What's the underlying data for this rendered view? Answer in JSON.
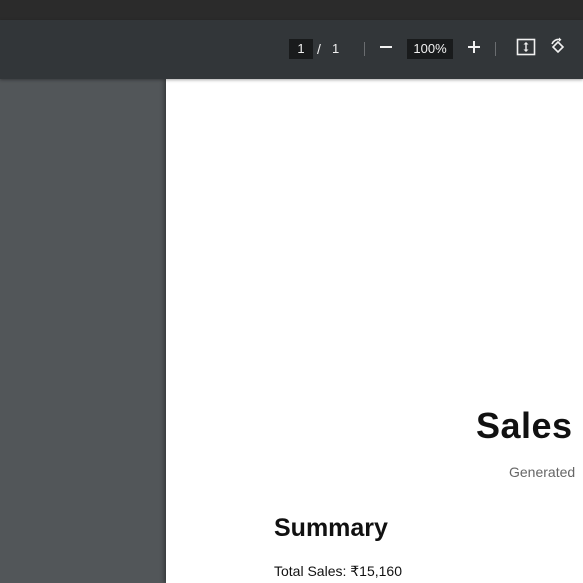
{
  "toolbar": {
    "page_current": "1",
    "page_separator": "/",
    "page_total": "1",
    "zoom": "100%",
    "icons": {
      "zoom_out": "minus-icon",
      "zoom_in": "plus-icon",
      "fit": "fit-to-page-icon",
      "rotate": "rotate-icon"
    },
    "colors": {
      "toolbar_bg": "#323639",
      "field_bg": "#191b1c",
      "text": "#f1f1f1"
    }
  },
  "viewer": {
    "background": "#525659"
  },
  "document": {
    "title": "Sales I",
    "subtitle": "Generated",
    "summary_heading": "Summary",
    "total_sales": "Total Sales: ₹15,160"
  }
}
